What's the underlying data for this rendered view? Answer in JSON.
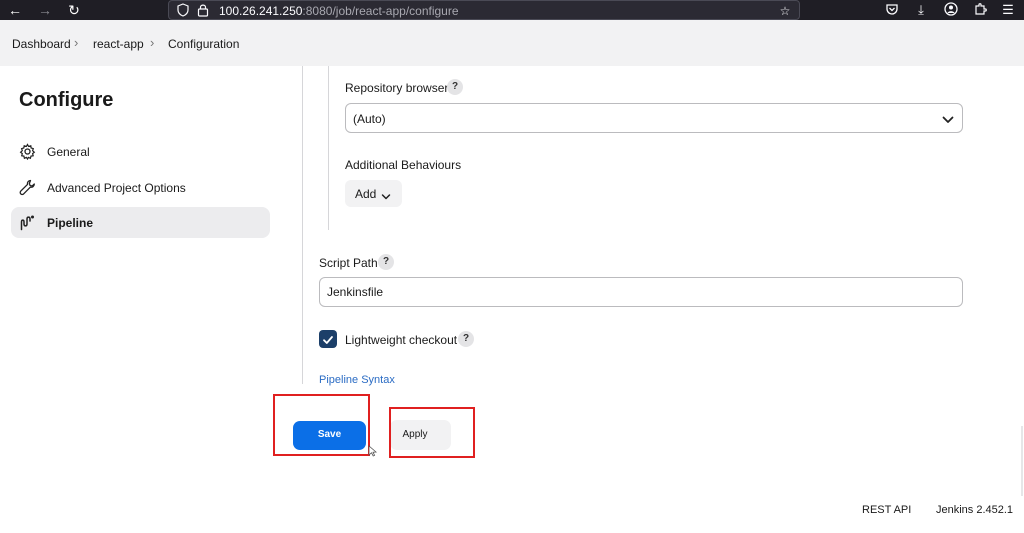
{
  "browser": {
    "url_host": "100.26.241.250",
    "url_rest": ":8080/job/react-app/configure"
  },
  "breadcrumb": {
    "items": [
      "Dashboard",
      "react-app",
      "Configuration"
    ]
  },
  "sidebar": {
    "title": "Configure",
    "items": [
      {
        "label": "General",
        "icon": "gear-icon",
        "active": false
      },
      {
        "label": "Advanced Project Options",
        "icon": "wrench-icon",
        "active": false
      },
      {
        "label": "Pipeline",
        "icon": "pipeline-icon",
        "active": true
      }
    ]
  },
  "main": {
    "repository_browser_label": "Repository browser",
    "repository_browser_value": "(Auto)",
    "additional_behaviours_label": "Additional Behaviours",
    "add_label": "Add",
    "script_path_label": "Script Path",
    "script_path_value": "Jenkinsfile",
    "lightweight_checkout_label": "Lightweight checkout",
    "lightweight_checkout_checked": true,
    "pipeline_syntax_link": "Pipeline Syntax",
    "help_glyph": "?"
  },
  "buttons": {
    "save": "Save",
    "apply": "Apply"
  },
  "footer": {
    "rest_api": "REST API",
    "version": "Jenkins 2.452.1"
  },
  "colors": {
    "primary": "#0b6fe7",
    "checkbox": "#1c3f69",
    "link": "#2b6cc4",
    "highlight": "#e02020"
  }
}
